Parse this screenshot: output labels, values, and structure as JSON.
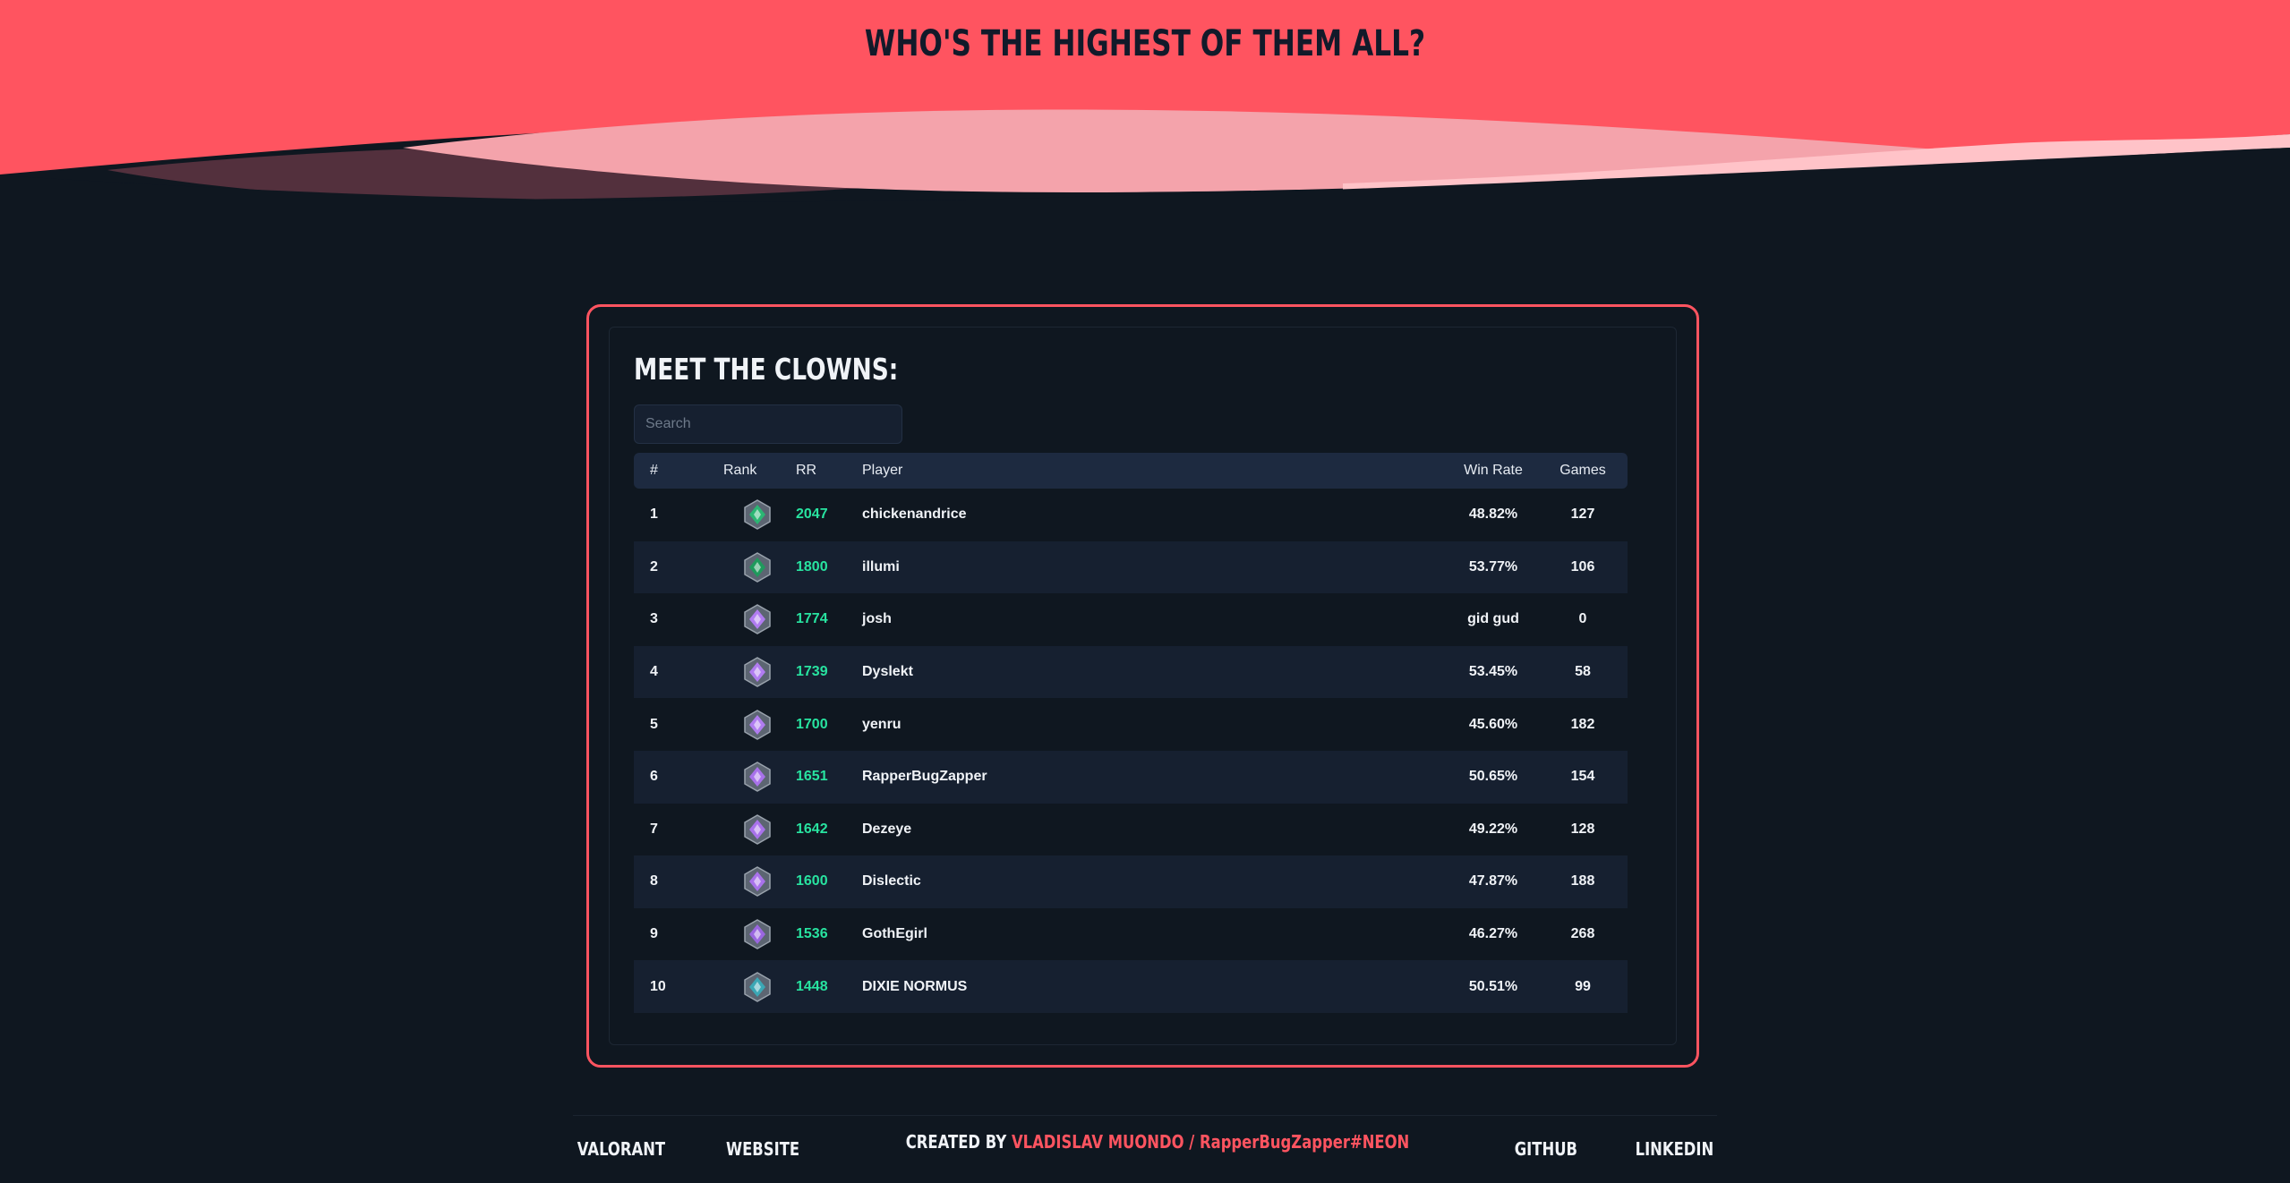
{
  "header": {
    "title": "WHO'S THE HIGHEST OF THEM ALL?",
    "accent_color": "#ff5460"
  },
  "card": {
    "title": "MEET THE CLOWNS:",
    "search": {
      "placeholder": "Search",
      "value": ""
    }
  },
  "table": {
    "headers": {
      "num": "#",
      "rank": "Rank",
      "rr": "RR",
      "player": "Player",
      "win_rate": "Win Rate",
      "games": "Games"
    },
    "rows": [
      {
        "num": "1",
        "rank_icon": "ascendant-rank-icon",
        "rank_color": "#2bb673",
        "rr": "2047",
        "player": "chickenandrice",
        "win_rate": "48.82%",
        "games": "127"
      },
      {
        "num": "2",
        "rank_icon": "ascendant-rank-icon",
        "rank_color": "#1f9a5c",
        "rr": "1800",
        "player": "illumi",
        "win_rate": "53.77%",
        "games": "106"
      },
      {
        "num": "3",
        "rank_icon": "diamond-rank-icon",
        "rank_color": "#b07cf0",
        "rr": "1774",
        "player": "josh",
        "win_rate": "gid gud",
        "games": "0"
      },
      {
        "num": "4",
        "rank_icon": "diamond-rank-icon",
        "rank_color": "#b07cf0",
        "rr": "1739",
        "player": "Dyslekt",
        "win_rate": "53.45%",
        "games": "58"
      },
      {
        "num": "5",
        "rank_icon": "diamond-rank-icon",
        "rank_color": "#b07cf0",
        "rr": "1700",
        "player": "yenru",
        "win_rate": "45.60%",
        "games": "182"
      },
      {
        "num": "6",
        "rank_icon": "diamond-rank-icon",
        "rank_color": "#a872ea",
        "rr": "1651",
        "player": "RapperBugZapper",
        "win_rate": "50.65%",
        "games": "154"
      },
      {
        "num": "7",
        "rank_icon": "diamond-rank-icon",
        "rank_color": "#a872ea",
        "rr": "1642",
        "player": "Dezeye",
        "win_rate": "49.22%",
        "games": "128"
      },
      {
        "num": "8",
        "rank_icon": "diamond-rank-icon",
        "rank_color": "#a872ea",
        "rr": "1600",
        "player": "Dislectic",
        "win_rate": "47.87%",
        "games": "188"
      },
      {
        "num": "9",
        "rank_icon": "diamond-rank-icon",
        "rank_color": "#9a66e0",
        "rr": "1536",
        "player": "GothEgirl",
        "win_rate": "46.27%",
        "games": "268"
      },
      {
        "num": "10",
        "rank_icon": "platinum-rank-icon",
        "rank_color": "#3ba7b5",
        "rr": "1448",
        "player": "DIXIE NORMUS",
        "win_rate": "50.51%",
        "games": "99"
      }
    ]
  },
  "footer": {
    "valorant": "VALORANT",
    "website": "WEBSITE",
    "created_by": "CREATED BY",
    "author": "VLADISLAV MUONDO / RapperBugZapper#NEON",
    "github": "GITHUB",
    "linkedin": "LINKEDIN"
  },
  "colors": {
    "background": "#0f1720",
    "rr_green": "#28e3a0",
    "row_alt": "#162030",
    "header_row": "#1d2a40"
  }
}
